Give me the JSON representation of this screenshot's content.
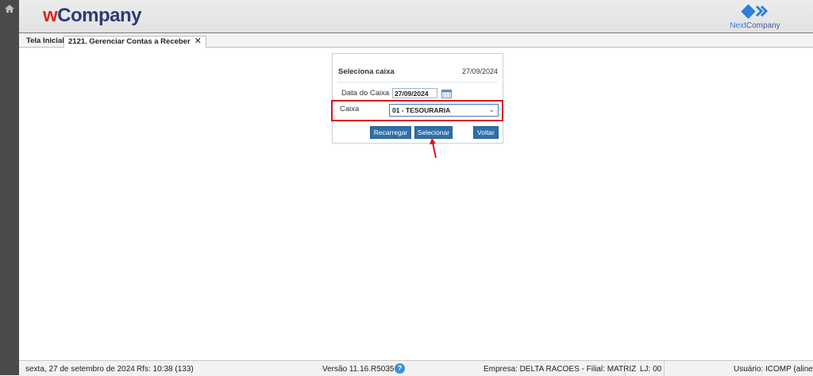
{
  "header": {
    "logo_w": "w",
    "logo_rest": "Company",
    "brand_next_prefix": "Next",
    "brand_next_suffix": "Company"
  },
  "tabs": {
    "home_label": "Tela Inicial",
    "active_label": "2121. Gerenciar Contas a Receber",
    "close_glyph": "✕"
  },
  "dialog": {
    "title": "Seleciona caixa",
    "date": "27/09/2024",
    "date_label": "Data do Caixa",
    "date_value": "27/09/2024",
    "caixa_label": "Caixa",
    "caixa_value": "01 - TESOURARIA",
    "reload_label": "Recarregar",
    "select_label": "Selecionar",
    "back_label": "Voltar"
  },
  "status": {
    "date_text": "sexta, 27 de setembro de 2024",
    "rfs_text": "Rfs: 10:38 (133)",
    "version_text": "Versão 11.16.R5035",
    "help_glyph": "?",
    "company_text": "Empresa: DELTA RACOES - Filial: MATRIZ",
    "lj_text": "LJ: 00",
    "user_text": "Usuário: ICOMP (aline)"
  },
  "colors": {
    "logo_red": "#d22b1f",
    "logo_navy": "#2d3a7a",
    "button_blue": "#2f6fa8",
    "highlight_red": "#e0121a",
    "rail_gray": "#4a4a4a"
  }
}
